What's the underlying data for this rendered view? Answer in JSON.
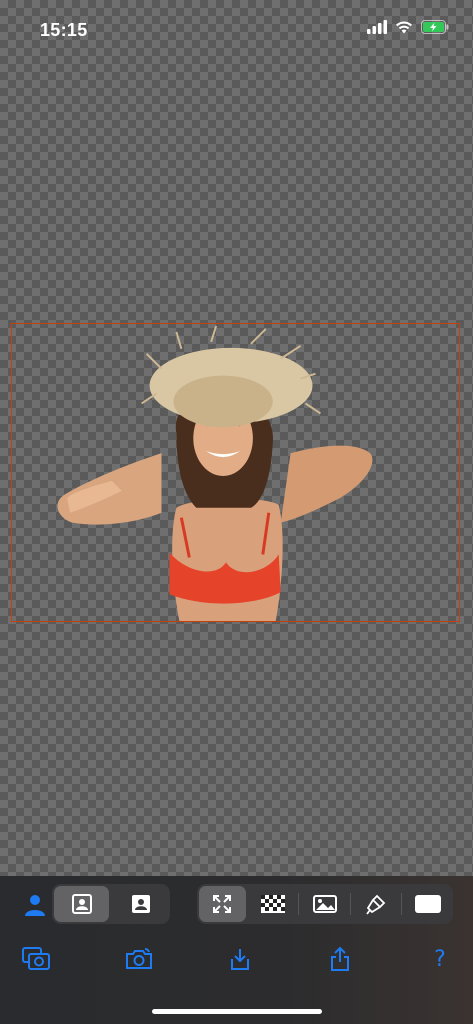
{
  "status_bar": {
    "time": "15:15",
    "icons": [
      "signal-icon",
      "wifi-icon",
      "battery-charging-icon"
    ]
  },
  "colors": {
    "accent": "#1e7bf2",
    "frame_border": "#c2410c",
    "toolbar_bg": "#2c2c2e",
    "segment_bg": "#3a3a3c",
    "segment_active": "#636366"
  },
  "canvas": {
    "content": "cutout-photo-woman-straw-hat-red-top",
    "background": "transparency-checkerboard"
  },
  "toolbar": {
    "mode_icon": "person-icon",
    "segment_a": [
      {
        "icon": "portrait-frame-icon",
        "active": true
      },
      {
        "icon": "portrait-filled-icon",
        "active": false
      }
    ],
    "segment_b": [
      {
        "icon": "expand-arrows-icon",
        "active": true
      },
      {
        "icon": "checkerboard-icon",
        "active": false
      },
      {
        "icon": "image-icon",
        "active": false
      },
      {
        "icon": "brush-icon",
        "active": false
      },
      {
        "icon": "white-rectangle-icon",
        "active": false
      }
    ],
    "actions": [
      {
        "icon": "photo-library-camera-icon"
      },
      {
        "icon": "camera-icon"
      },
      {
        "icon": "download-icon"
      },
      {
        "icon": "share-icon"
      },
      {
        "icon": "help-icon",
        "label": "?"
      }
    ]
  }
}
